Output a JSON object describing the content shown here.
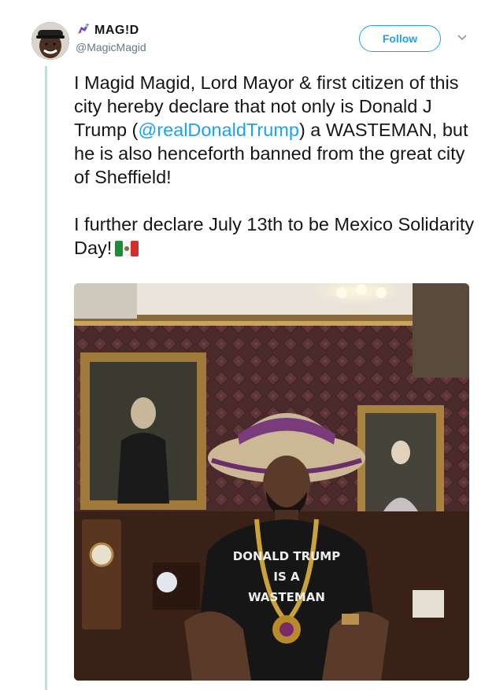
{
  "author": {
    "display_name": "MAG!D",
    "handle": "@MagicMagid"
  },
  "follow_label": "Follow",
  "tweet": {
    "line1_pre": "I Magid Magid, Lord Mayor & first citizen of this city hereby declare that not only is Donald J Trump (",
    "mention": "@realDonaldTrump",
    "line1_post": ") a WASTEMAN, but he is also henceforth banned from the great city of Sheffield!",
    "line2": "I further declare July 13th to be Mexico Solidarity Day!"
  },
  "media": {
    "shirt_line1": "DONALD TRUMP",
    "shirt_line2": "IS A",
    "shirt_line3": "WASTEMAN"
  },
  "colors": {
    "accent": "#1da1f2",
    "thread": "#b3e8d8",
    "text": "#14171a",
    "secondary": "#657786"
  }
}
